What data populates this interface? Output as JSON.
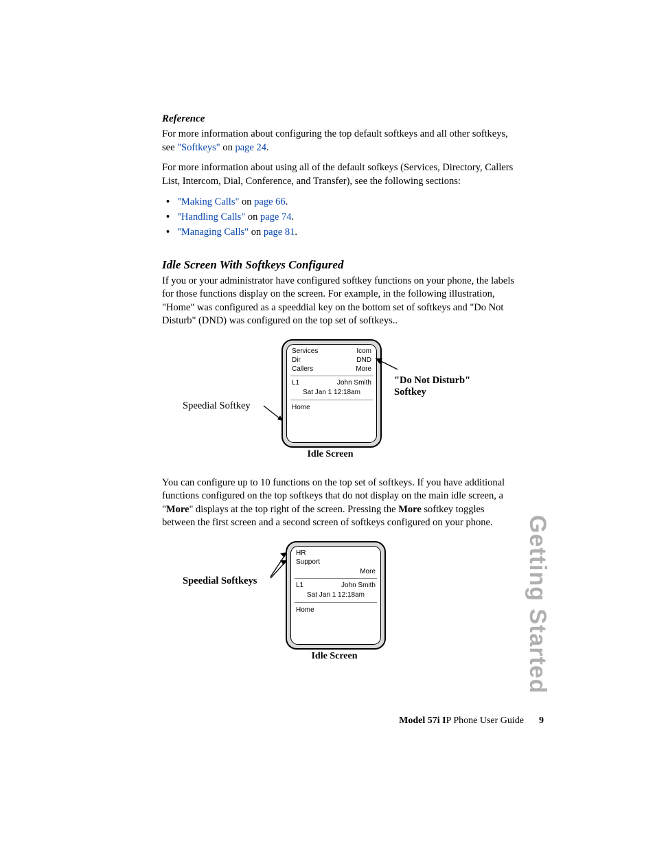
{
  "reference": {
    "heading": "Reference",
    "para1_pre": "For more information about configuring the top default softkeys and all other softkeys, see ",
    "link1": "\"Softkeys\"",
    "mid1": " on ",
    "pagelink1": "page 24",
    "para1_end": ".",
    "para2": "For more information about using all of the default sofkeys (Services, Directory, Callers List, Intercom, Dial, Conference, and Transfer), see the following sections:",
    "bullets": [
      {
        "link": "\"Making Calls\"",
        "mid": " on ",
        "page": "page 66",
        "end": "."
      },
      {
        "link": "\"Handling Calls\"",
        "mid": " on ",
        "page": "page 74",
        "end": "."
      },
      {
        "link": "\"Managing Calls\"",
        "mid": " on ",
        "page": "page 81",
        "end": "."
      }
    ]
  },
  "section2": {
    "heading": "Idle Screen With Softkeys Configured",
    "para": "If you or your administrator have configured softkey functions on your phone, the labels for those functions display on the screen. For example, in the following illustration, \"Home\" was configured as a speeddial key on the bottom set of softkeys and \"Do Not Disturb\" (DND) was configured on the top set of softkeys.."
  },
  "fig1": {
    "left_label": "Speedial Softkey",
    "right_label1": "\"Do Not Disturb\"",
    "right_label2": "Softkey",
    "caption": "Idle Screen",
    "screen": {
      "tl": [
        "Services",
        "Dir",
        "Callers"
      ],
      "tr": [
        "Icom",
        "DND",
        "More"
      ],
      "l1": "L1",
      "name": "John Smith",
      "date": "Sat  Jan 1  12:18am",
      "home": "Home"
    }
  },
  "para_more": {
    "t1": "You can configure up to 10 functions on the top set of softkeys. If you have additional functions configured on the top softkeys that do not display on the main idle screen, a \"",
    "b1": "More",
    "t2": "\" displays at the top right of the screen. Pressing the ",
    "b2": "More",
    "t3": " softkey toggles between the first screen and a second screen of softkeys configured on your phone."
  },
  "fig2": {
    "left_label": "Speedial Softkeys",
    "caption": "Idle Screen",
    "screen": {
      "tl": [
        "HR",
        "Support"
      ],
      "tr_more": "More",
      "l1": "L1",
      "name": "John Smith",
      "date": "Sat  Jan 1  12:18am",
      "home": "Home"
    }
  },
  "side": "Getting Started",
  "footer": {
    "a": "Model 57i I",
    "b": "P Phone User Guide",
    "page": "9"
  }
}
